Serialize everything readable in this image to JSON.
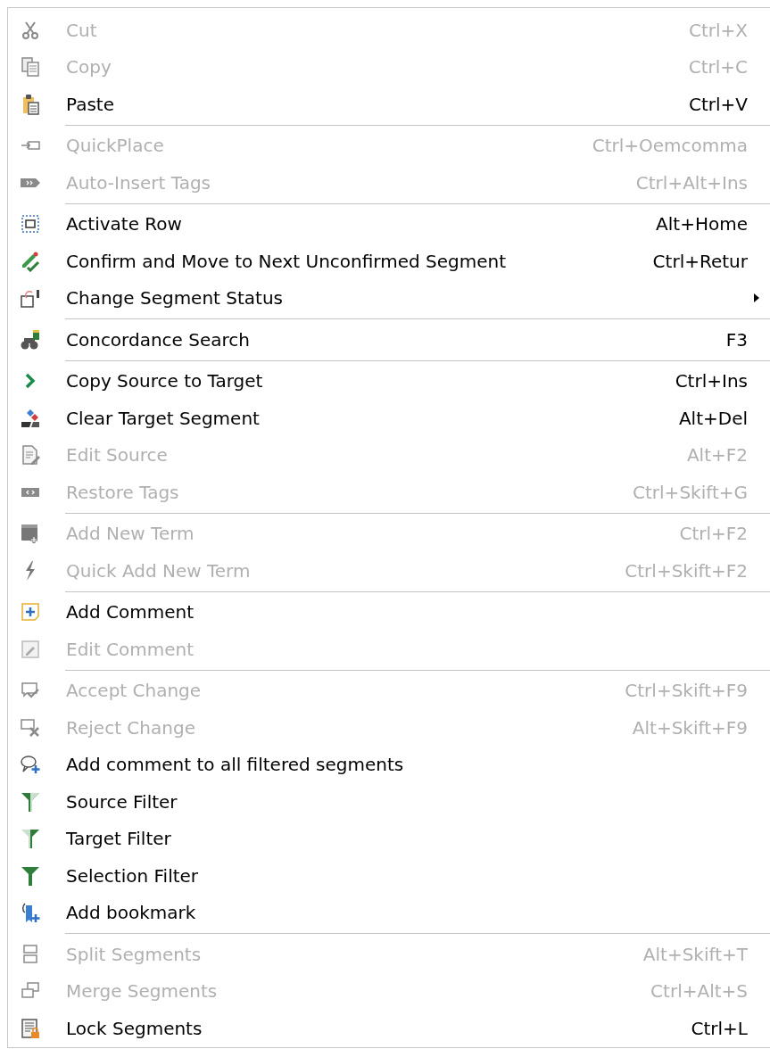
{
  "menu": {
    "sections": [
      {
        "items": [
          {
            "label": "Cut",
            "shortcut": "Ctrl+X",
            "disabled": true
          },
          {
            "label": "Copy",
            "shortcut": "Ctrl+C",
            "disabled": true
          },
          {
            "label": "Paste",
            "shortcut": "Ctrl+V",
            "disabled": false
          }
        ]
      },
      {
        "items": [
          {
            "label": "QuickPlace",
            "shortcut": "Ctrl+Oemcomma",
            "disabled": true
          },
          {
            "label": "Auto-Insert Tags",
            "shortcut": "Ctrl+Alt+Ins",
            "disabled": true
          }
        ]
      },
      {
        "items": [
          {
            "label": "Activate Row",
            "shortcut": "Alt+Home",
            "disabled": false
          },
          {
            "label": "Confirm and Move to Next Unconfirmed Segment",
            "shortcut": "Ctrl+Retur",
            "disabled": false
          },
          {
            "label": "Change Segment Status",
            "disabled": false,
            "has_submenu": true
          }
        ]
      },
      {
        "items": [
          {
            "label": "Concordance Search",
            "shortcut": "F3",
            "disabled": false
          }
        ]
      },
      {
        "items": [
          {
            "label": "Copy Source to Target",
            "shortcut": "Ctrl+Ins",
            "disabled": false
          },
          {
            "label": "Clear Target Segment",
            "shortcut": "Alt+Del",
            "disabled": false
          },
          {
            "label": "Edit Source",
            "shortcut": "Alt+F2",
            "disabled": true
          },
          {
            "label": "Restore Tags",
            "shortcut": "Ctrl+Skift+G",
            "disabled": true
          }
        ]
      },
      {
        "items": [
          {
            "label": "Add New Term",
            "shortcut": "Ctrl+F2",
            "disabled": true
          },
          {
            "label": "Quick Add New Term",
            "shortcut": "Ctrl+Skift+F2",
            "disabled": true
          }
        ]
      },
      {
        "items": [
          {
            "label": "Add Comment",
            "disabled": false
          },
          {
            "label": "Edit Comment",
            "disabled": true
          }
        ]
      },
      {
        "items": [
          {
            "label": "Accept Change",
            "shortcut": "Ctrl+Skift+F9",
            "disabled": true
          },
          {
            "label": "Reject Change",
            "shortcut": "Alt+Skift+F9",
            "disabled": true
          },
          {
            "label": "Add comment to all filtered segments",
            "disabled": false
          },
          {
            "label": "Source Filter",
            "disabled": false
          },
          {
            "label": "Target Filter",
            "disabled": false
          },
          {
            "label": "Selection Filter",
            "disabled": false
          },
          {
            "label": "Add bookmark",
            "disabled": false
          }
        ]
      },
      {
        "items": [
          {
            "label": "Split Segments",
            "shortcut": "Alt+Skift+T",
            "disabled": true
          },
          {
            "label": "Merge Segments",
            "shortcut": "Ctrl+Alt+S",
            "disabled": true
          },
          {
            "label": "Lock Segments",
            "shortcut": "Ctrl+L",
            "disabled": false
          }
        ]
      }
    ]
  }
}
